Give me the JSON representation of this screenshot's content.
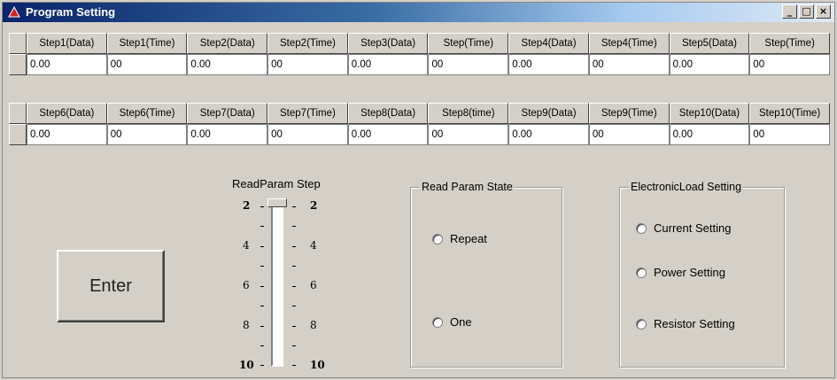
{
  "window": {
    "title": "Program Setting",
    "controls": {
      "minimize": "_",
      "maximize": "□",
      "close": "×"
    }
  },
  "table1": {
    "headers": [
      "Step1(Data)",
      "Step1(Time)",
      "Step2(Data)",
      "Step2(Time)",
      "Step3(Data)",
      "Step(Time)",
      "Step4(Data)",
      "Step4(Time)",
      "Step5(Data)",
      "Step(Time)"
    ],
    "values": [
      "0.00",
      "00",
      "0.00",
      "00",
      "0.00",
      "00",
      "0.00",
      "00",
      "0.00",
      "00"
    ]
  },
  "table2": {
    "headers": [
      "Step6(Data)",
      "Step6(Time)",
      "Step7(Data)",
      "Step7(Time)",
      "Step8(Data)",
      "Step8(time)",
      "Step9(Data)",
      "Step9(Time)",
      "Step10(Data)",
      "Step10(Time)"
    ],
    "values": [
      "0.00",
      "00",
      "0.00",
      "00",
      "0.00",
      "00",
      "0.00",
      "00",
      "0.00",
      "00"
    ]
  },
  "enter_button": {
    "label": "Enter"
  },
  "slider": {
    "label": "ReadParam Step",
    "left_ticks": [
      "2",
      "4",
      "6",
      "8",
      "10"
    ],
    "right_ticks": [
      "2",
      "4",
      "6",
      "8",
      "10"
    ],
    "value": 2
  },
  "read_param_state": {
    "title": "Read Param State",
    "options": [
      "Repeat",
      "One"
    ]
  },
  "electronic_load": {
    "title": "ElectronicLoad Setting",
    "options": [
      "Current Setting",
      "Power Setting",
      "Resistor Setting"
    ]
  }
}
